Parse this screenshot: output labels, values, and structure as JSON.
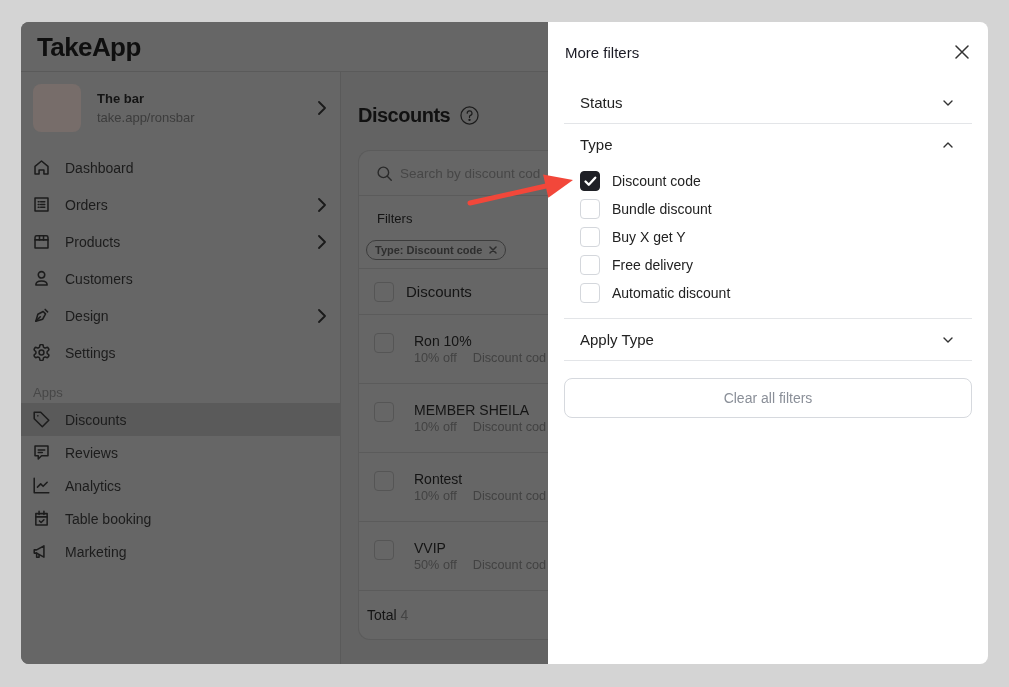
{
  "app": {
    "logo": "TakeApp"
  },
  "store": {
    "name": "The bar",
    "url": "take.app/ronsbar"
  },
  "sidebar": {
    "items": [
      {
        "label": "Dashboard",
        "has_submenu": false,
        "selected": false
      },
      {
        "label": "Orders",
        "has_submenu": true,
        "selected": false
      },
      {
        "label": "Products",
        "has_submenu": true,
        "selected": false
      },
      {
        "label": "Customers",
        "has_submenu": false,
        "selected": false
      },
      {
        "label": "Design",
        "has_submenu": true,
        "selected": false
      },
      {
        "label": "Settings",
        "has_submenu": false,
        "selected": false
      }
    ],
    "apps": {
      "label": "Apps",
      "items": [
        {
          "label": "Discounts",
          "selected": true
        },
        {
          "label": "Reviews",
          "selected": false
        },
        {
          "label": "Analytics",
          "selected": false
        },
        {
          "label": "Table booking",
          "selected": false
        },
        {
          "label": "Marketing",
          "selected": false
        }
      ]
    }
  },
  "page": {
    "title": "Discounts",
    "search": {
      "placeholder": "Search by discount cod"
    },
    "filters_label": "Filters",
    "active_filters": [
      "Type: Discount code"
    ],
    "table": {
      "header": {
        "label": "Discounts",
        "checked": false
      },
      "rows": [
        {
          "name": "Ron 10%",
          "amount": "10% off",
          "type": "Discount cod",
          "checked": false
        },
        {
          "name": "MEMBER SHEILA",
          "amount": "10% off",
          "type": "Discount cod",
          "checked": false
        },
        {
          "name": "Rontest",
          "amount": "10% off",
          "type": "Discount cod",
          "checked": false
        },
        {
          "name": "VVIP",
          "amount": "50% off",
          "type": "Discount cod",
          "checked": false
        }
      ],
      "total_label": "Total",
      "total": "4"
    }
  },
  "drawer": {
    "title": "More filters",
    "sections": [
      {
        "title": "Status",
        "expanded": false
      },
      {
        "title": "Type",
        "expanded": true,
        "options": [
          {
            "label": "Discount code",
            "checked": true
          },
          {
            "label": "Bundle discount",
            "checked": false
          },
          {
            "label": "Buy X get Y",
            "checked": false
          },
          {
            "label": "Free delivery",
            "checked": false
          },
          {
            "label": "Automatic discount",
            "checked": false
          }
        ]
      },
      {
        "title": "Apply Type",
        "expanded": false
      }
    ],
    "clear_button": "Clear all filters"
  }
}
